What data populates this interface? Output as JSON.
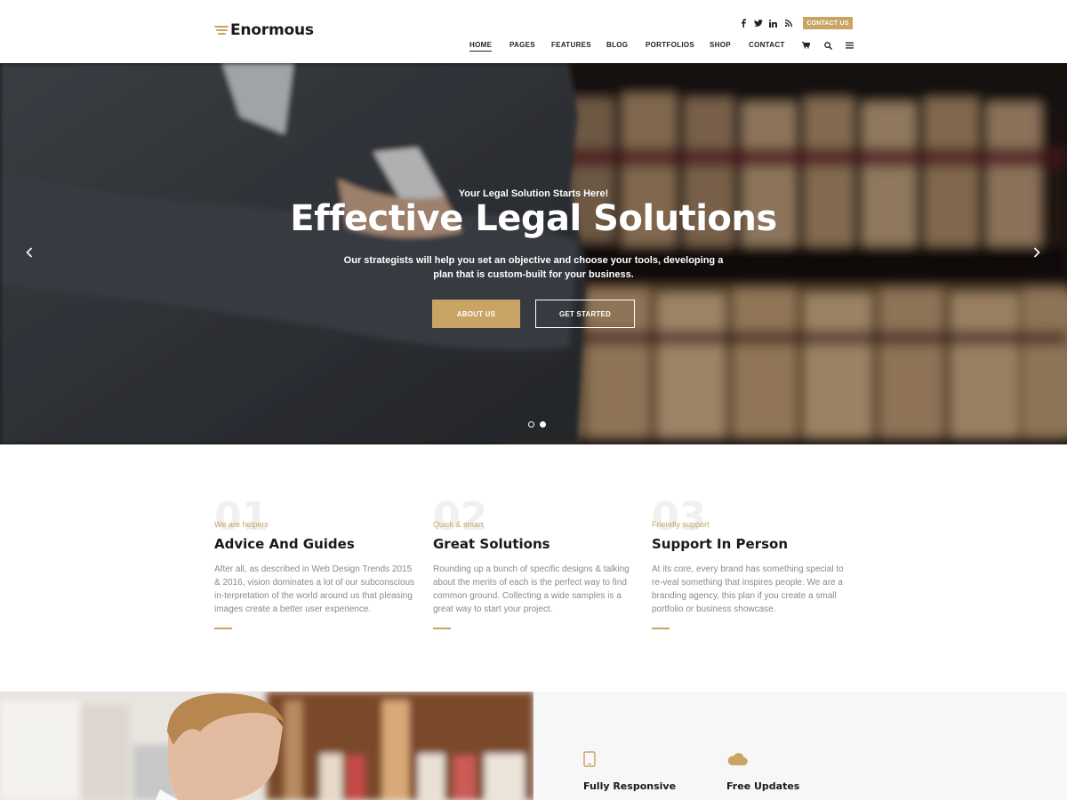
{
  "header": {
    "logo_text": "Enormous",
    "contact_label": "CONTACT US",
    "social_icons": [
      "facebook-icon",
      "twitter-icon",
      "linkedin-icon",
      "rss-icon"
    ],
    "nav": [
      {
        "label": "HOME",
        "active": true
      },
      {
        "label": "PAGES"
      },
      {
        "label": "FEATURES"
      },
      {
        "label": "BLOG"
      },
      {
        "label": "PORTFOLIOS"
      },
      {
        "label": "SHOP"
      },
      {
        "label": "CONTACT"
      }
    ],
    "nav_icons": [
      "cart-icon",
      "search-icon",
      "menu-icon"
    ]
  },
  "hero": {
    "subtitle": "Your Legal Solution Starts Here!",
    "title": "Effective Legal Solutions",
    "description": "Our strategists will help you set an objective and choose your tools, developing a plan that is custom-built for your business.",
    "primary_button": "ABOUT US",
    "secondary_button": "GET STARTED",
    "slide_count": 2,
    "active_slide": 2
  },
  "features": [
    {
      "number": "01",
      "eyebrow": "We are helpers",
      "title": "Advice And Guides",
      "text": "After all, as described in Web Design Trends 2015 & 2016, vision dominates a lot of our subconscious in-terpretation of the world around us that pleasing images create a better user experience."
    },
    {
      "number": "02",
      "eyebrow": "Quick & smart",
      "title": "Great Solutions",
      "text": "Rounding up a bunch of specific designs & talking about the merits of each is the perfect way to find common ground. Collecting a wide samples is a great way to start your project."
    },
    {
      "number": "03",
      "eyebrow": "Friendly support",
      "title": "Support In Person",
      "text": "At its core, every brand has something special to re-veal something that inspires people. We are a branding agency, this plan if you create a small portfolio or business showcase."
    }
  ],
  "bottom": {
    "items": [
      {
        "icon": "tablet-icon",
        "title": "Fully Responsive"
      },
      {
        "icon": "cloud-icon",
        "title": "Free Updates"
      }
    ]
  },
  "colors": {
    "accent": "#c9a464",
    "heading": "#1a1a1a",
    "body_text": "#8a8a8a",
    "panel_bg": "#f7f7f7"
  }
}
